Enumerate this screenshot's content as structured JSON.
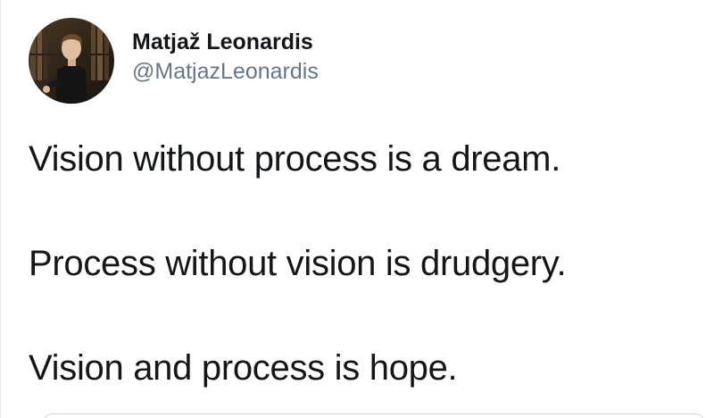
{
  "tweet": {
    "author": {
      "display_name": "Matjaž Leonardis",
      "handle": "@MatjazLeonardis"
    },
    "lines": [
      "Vision without process is a dream.",
      "Process without vision is drudgery.",
      "Vision and process is hope."
    ]
  },
  "colors": {
    "text": "#14171a",
    "secondary": "#657786",
    "border": "#ccd6dd"
  }
}
